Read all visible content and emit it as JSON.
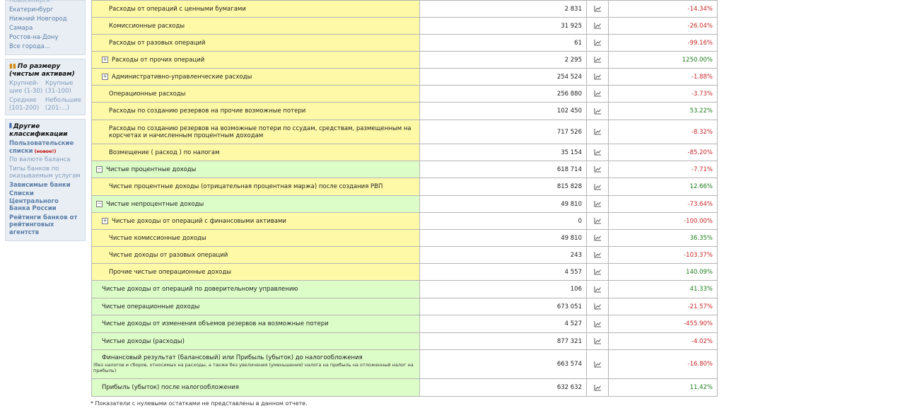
{
  "sidebar": {
    "cities": [
      "Новосибирск",
      "Екатеринбург",
      "Нижний Новгород",
      "Самара",
      "Ростов-на-Дону",
      "Все города..."
    ],
    "size_heading": "По размеру (чистым активам)",
    "size_items": [
      "Крупней-шие (1-30)",
      "Крупные (31-100)",
      "Средние (101-200)",
      "Небольшие (201-...)"
    ],
    "other_heading": "Другие классификации",
    "user_lists": "Пользовательские списки",
    "new_badge": "(новое!)",
    "other_links": [
      "По валюте баланса",
      "Типы банков по оказываемым услугам"
    ],
    "bold_links": [
      "Зависимые банки",
      "Списки Центрального Банка России",
      "Рейтинги банков от рейтинговых агентств"
    ]
  },
  "rows": [
    {
      "name": "Расходы от операций с ценными бумагами",
      "value": "2 831",
      "change": "-14.34%"
    },
    {
      "name": "Комиссионные расходы",
      "value": "31 925",
      "change": "-26.04%"
    },
    {
      "name": "Расходы от разовых операций",
      "value": "61",
      "change": "-99.16%"
    },
    {
      "name": "Расходы от прочих операций",
      "value": "2 295",
      "change": "1250.00%"
    },
    {
      "name": "Административно-управленческие расходы",
      "value": "254 524",
      "change": "-1.88%"
    },
    {
      "name": "Операционные расходы",
      "value": "256 880",
      "change": "-3.73%"
    },
    {
      "name": "Расходы по созданию резервов на прочие возможные потери",
      "value": "102 450",
      "change": "53.22%"
    },
    {
      "name": "Расходы по созданию резервов на возможные потери по ссудам, средствам, размещенным на корсчетах и начисленным процентным доходам",
      "value": "717 526",
      "change": "-8.32%"
    },
    {
      "name": "Возмещение ( расход ) по налогам",
      "value": "35 154",
      "change": "-85.20%"
    },
    {
      "name": "Чистые процентные доходы",
      "value": "618 714",
      "change": "-7.71%"
    },
    {
      "name": "Чистые процентные доходы (отрицательная процентная маржа) после создания РВП",
      "value": "815 828",
      "change": "12.66%"
    },
    {
      "name": "Чистые непроцентные доходы",
      "value": "49 810",
      "change": "-73.64%"
    },
    {
      "name": "Чистые доходы от операций с финансовыми активами",
      "value": "0",
      "change": "-100.00%"
    },
    {
      "name": "Чистые комиссионные доходы",
      "value": "49 810",
      "change": "36.35%"
    },
    {
      "name": "Чистые доходы от разовых операций",
      "value": "243",
      "change": "-103.37%"
    },
    {
      "name": "Прочие чистые операционные доходы",
      "value": "4 557",
      "change": "140.09%"
    },
    {
      "name": "Чистые доходы от операций по доверительному управлению",
      "value": "106",
      "change": "41.33%"
    },
    {
      "name": "Чистые операционные доходы",
      "value": "673 051",
      "change": "-21.57%"
    },
    {
      "name": "Чистые доходы от изменения объемов резервов на возможные потери",
      "value": "4 527",
      "change": "-455.90%"
    },
    {
      "name": "Чистые доходы (расходы)",
      "value": "877 321",
      "change": "-4.02%"
    },
    {
      "name": "Финансовый результат (балансовый) или Прибыль (убыток) до налогообложения",
      "note": "(без налогов и сборов, относимых на расходы, а также без увеличения (уменьшения) налога на прибыль на отложенный налог на прибыль)",
      "value": "663 574",
      "change": "-16.80%"
    },
    {
      "name": "Прибыль (убыток) после налогообложения",
      "value": "632 632",
      "change": "11.42%"
    }
  ],
  "footnote": "* Показатели с нулевыми остатками не представлены в данном отчете.",
  "colors": {
    "yellow_row": "#fef9a6",
    "green_row": "#dcfcc8",
    "negative": "#c62828",
    "positive": "#1e7d1e"
  }
}
